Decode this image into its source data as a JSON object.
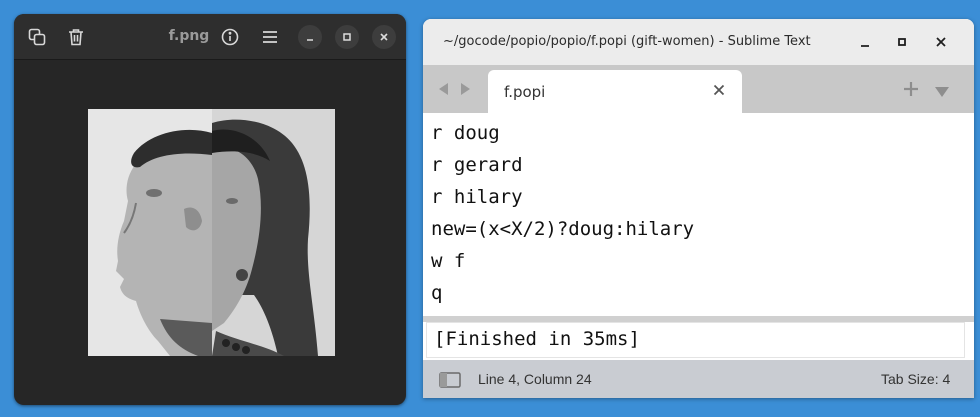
{
  "viewer": {
    "title": "f.png",
    "image_alt": "split face portrait: man on left, woman on right"
  },
  "sublime": {
    "title": "~/gocode/popio/popio/f.popi (gift-women) - Sublime Text",
    "tab": {
      "label": "f.popi"
    },
    "code_lines": [
      "r doug",
      "r gerard",
      "r hilary",
      "new=(x<X/2)?doug:hilary",
      "w f",
      "q"
    ],
    "output": "[Finished in 35ms]",
    "status": {
      "position": "Line 4, Column 24",
      "tab_size": "Tab Size: 4"
    }
  },
  "colors": {
    "desktop": "#3b8ed6",
    "viewer_bg": "#262626",
    "sublime_tabbar": "#c8c8c8",
    "statusbar": "#c9ccd2"
  }
}
